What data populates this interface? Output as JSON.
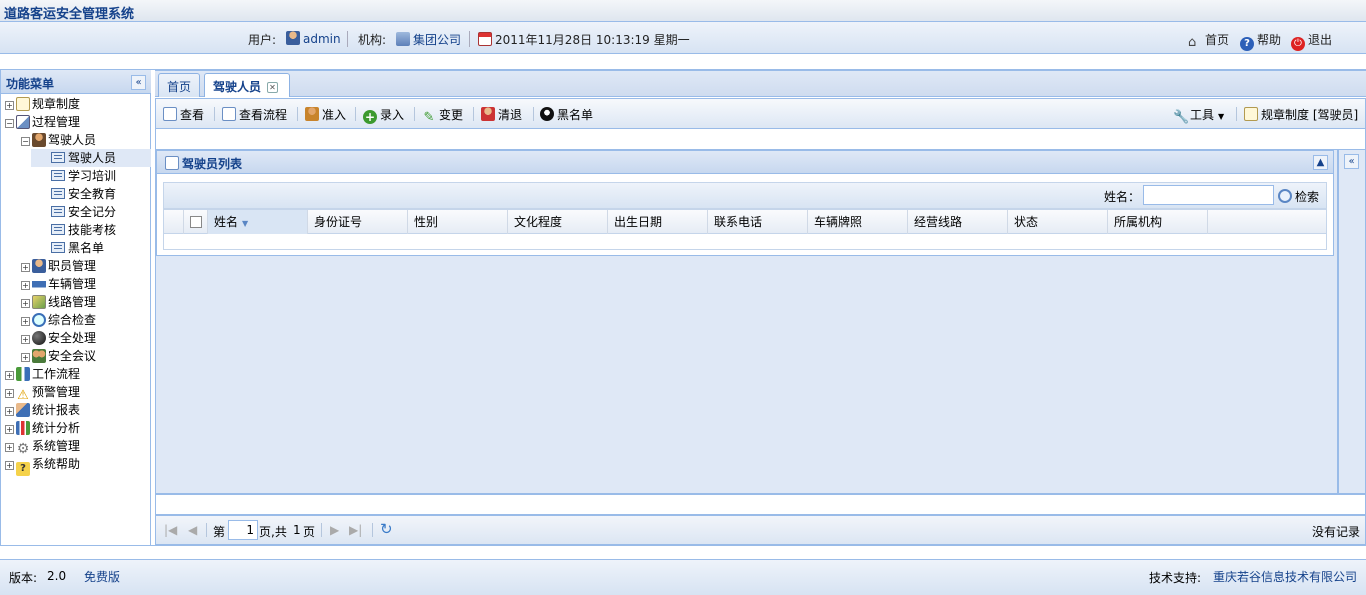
{
  "app": {
    "title": "道路客运安全管理系统"
  },
  "infobar": {
    "user_label": "用户:",
    "user_name": "admin",
    "org_label": "机构:",
    "org_name": "集团公司",
    "datetime": "2011年11月28日  10:13:19 星期一",
    "home": "首页",
    "help": "帮助",
    "logout": "退出"
  },
  "sidebar": {
    "title": "功能菜单",
    "items": [
      {
        "label": "规章制度",
        "icon": "document-icon"
      },
      {
        "label": "过程管理",
        "icon": "process-icon"
      },
      {
        "label": "驾驶人员",
        "icon": "driver-icon"
      },
      {
        "label": "驾驶人员",
        "icon": "list-icon"
      },
      {
        "label": "学习培训",
        "icon": "list-icon"
      },
      {
        "label": "安全教育",
        "icon": "list-icon"
      },
      {
        "label": "安全记分",
        "icon": "list-icon"
      },
      {
        "label": "技能考核",
        "icon": "list-icon"
      },
      {
        "label": "黑名单",
        "icon": "list-icon"
      },
      {
        "label": "职员管理",
        "icon": "staff-icon"
      },
      {
        "label": "车辆管理",
        "icon": "car-icon"
      },
      {
        "label": "线路管理",
        "icon": "route-icon"
      },
      {
        "label": "综合检查",
        "icon": "magnifier-icon"
      },
      {
        "label": "安全处理",
        "icon": "bomb-icon"
      },
      {
        "label": "安全会议",
        "icon": "meeting-icon"
      },
      {
        "label": "工作流程",
        "icon": "workflow-icon"
      },
      {
        "label": "预警管理",
        "icon": "warning-icon"
      },
      {
        "label": "统计报表",
        "icon": "report-icon"
      },
      {
        "label": "统计分析",
        "icon": "bar-chart-icon"
      },
      {
        "label": "系统管理",
        "icon": "gear-icon"
      },
      {
        "label": "系统帮助",
        "icon": "help-book-icon"
      }
    ]
  },
  "tabs": [
    {
      "label": "首页"
    },
    {
      "label": "驾驶人员"
    }
  ],
  "toolbar": {
    "view": "查看",
    "view_flow": "查看流程",
    "admit": "准入",
    "enter": "录入",
    "change": "变更",
    "dismiss": "清退",
    "blacklist": "黑名单",
    "tools": "工具",
    "rules": "规章制度",
    "rules_context": "[驾驶员]"
  },
  "grid": {
    "title": "驾驶员列表",
    "search_label": "姓名：",
    "search_value": "",
    "search_button": "检索",
    "columns": [
      "姓名",
      "身份证号",
      "性别",
      "文化程度",
      "出生日期",
      "联系电话",
      "车辆牌照",
      "经营线路",
      "状态",
      "所属机构"
    ]
  },
  "pager": {
    "page_prefix": "第",
    "page_value": "1",
    "page_suffix": "页,共",
    "total_pages": "1",
    "total_suffix": "页",
    "status": "没有记录"
  },
  "footer": {
    "version_label": "版本:",
    "version": "2.0",
    "edition": "免费版",
    "support_label": "技术支持:",
    "support_company": "重庆若谷信息技术有限公司"
  }
}
